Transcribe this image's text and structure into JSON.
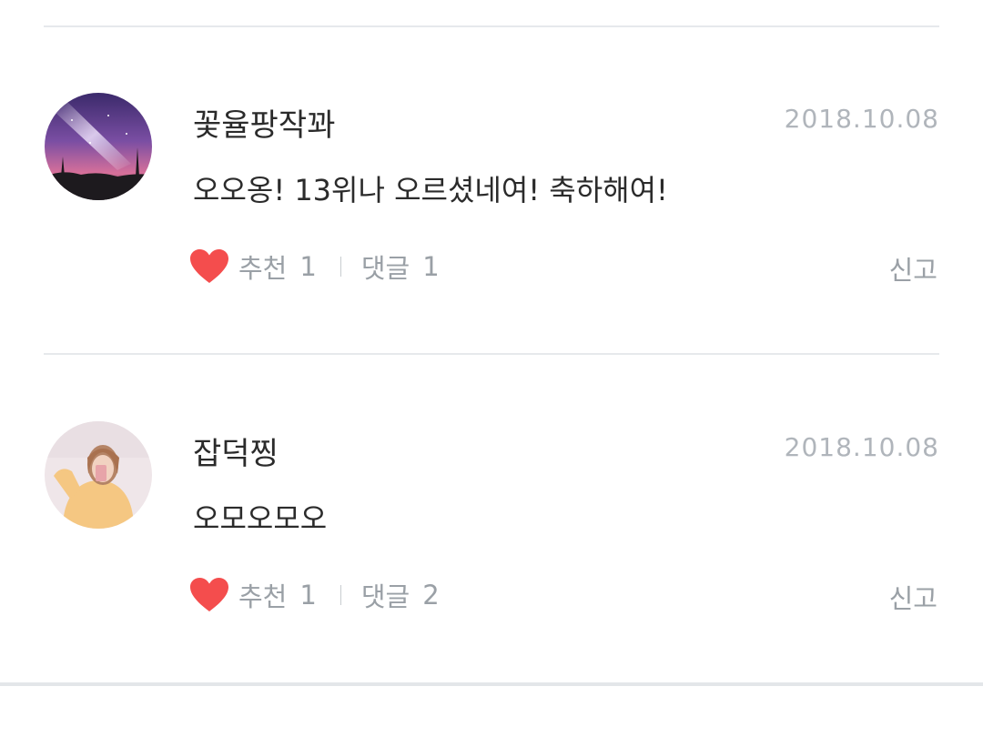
{
  "comments": [
    {
      "author": "꽃율팡작꽈",
      "date": "2018.10.08",
      "text": "오오옹! 13위나 오르셨네여! 축하해여!",
      "like_label": "추천",
      "like_count": "1",
      "reply_label": "댓글",
      "reply_count": "1",
      "report_label": "신고",
      "avatar_icon": "galaxy-avatar"
    },
    {
      "author": "잡덕찡",
      "date": "2018.10.08",
      "text": "오모오모오",
      "like_label": "추천",
      "like_count": "1",
      "reply_label": "댓글",
      "reply_count": "2",
      "report_label": "신고",
      "avatar_icon": "person-avatar"
    }
  ],
  "colors": {
    "heart": "#f44d4d",
    "meta_text": "#9aa0a6",
    "date_text": "#b0b5bb",
    "divider": "#e6e9ec"
  }
}
